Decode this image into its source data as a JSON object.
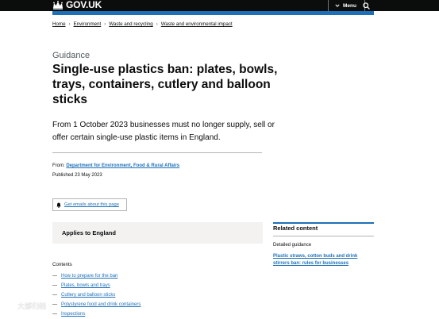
{
  "header": {
    "logo_text": "GOV.UK",
    "menu_label": "Menu"
  },
  "breadcrumb": [
    "Home",
    "Environment",
    "Waste and recycling",
    "Waste and environmental impact"
  ],
  "page": {
    "caption": "Guidance",
    "title": "Single-use plastics ban: plates, bowls, trays, containers, cutlery and balloon sticks",
    "lead": "From 1 October 2023 businesses must no longer supply, sell or offer certain single-use plastic items in England.",
    "from_label": "From:",
    "from_org": "Department for Environment, Food & Rural Affairs",
    "published": "Published 23 May 2023",
    "email_button": "Get emails about this page",
    "applies_to": "Applies to England"
  },
  "related": {
    "title": "Related content",
    "subheading": "Detailed guidance",
    "link": "Plastic straws, cotton buds and drink stirrers ban: rules for businesses"
  },
  "contents": {
    "label": "Contents",
    "items": [
      "How to prepare for the ban",
      "Plates, bowls and trays",
      "Cutlery and balloon sticks",
      "Polystyrene food and drink containers",
      "Inspections"
    ]
  },
  "watermark": "大部归档",
  "colors": {
    "header_bg": "#0b0c0c",
    "brand_blue": "#1d70b8",
    "panel_grey": "#f3f2f1"
  }
}
